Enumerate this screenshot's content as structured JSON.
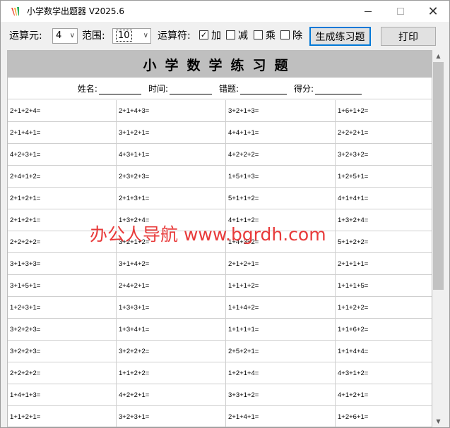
{
  "window": {
    "title": "小学数学出题器 V2025.6",
    "minimize_icon": "minimize-icon",
    "maximize_icon": "maximize-icon",
    "close_glyph": "✕"
  },
  "toolbar": {
    "operands_label": "运算元:",
    "operands_value": "4",
    "range_label": "范围:",
    "range_value": "10",
    "operators_label": "运算符:",
    "add_label": "加",
    "sub_label": "减",
    "mul_label": "乘",
    "div_label": "除",
    "add_checked": true,
    "sub_checked": false,
    "mul_checked": false,
    "div_checked": false,
    "generate_label": "生成练习题",
    "print_label": "打印",
    "check_glyph": "✓",
    "arrow_glyph": "∨"
  },
  "sheet": {
    "title": "小学数学练习题",
    "name_label": "姓名:",
    "time_label": "时间:",
    "errors_label": "错题:",
    "score_label": "得分:"
  },
  "problems": [
    [
      "2+1+2+4=",
      "2+1+4+3=",
      "3+2+1+3=",
      "1+6+1+2="
    ],
    [
      "2+1+4+1=",
      "3+1+2+1=",
      "4+4+1+1=",
      "2+2+2+1="
    ],
    [
      "4+2+3+1=",
      "4+3+1+1=",
      "4+2+2+2=",
      "3+2+3+2="
    ],
    [
      "2+4+1+2=",
      "2+3+2+3=",
      "1+5+1+3=",
      "1+2+5+1="
    ],
    [
      "2+1+2+1=",
      "2+1+3+1=",
      "5+1+1+2=",
      "4+1+4+1="
    ],
    [
      "2+1+2+1=",
      "1+3+2+4=",
      "4+1+1+2=",
      "1+3+2+4="
    ],
    [
      "2+2+2+2=",
      "3+2+1+2=",
      "1+4+3+2=",
      "5+1+2+2="
    ],
    [
      "3+1+3+3=",
      "3+1+4+2=",
      "2+1+2+1=",
      "2+1+1+1="
    ],
    [
      "3+1+5+1=",
      "2+4+2+1=",
      "1+1+1+2=",
      "1+1+1+5="
    ],
    [
      "1+2+3+1=",
      "1+3+3+1=",
      "1+1+4+2=",
      "1+1+2+2="
    ],
    [
      "3+2+2+3=",
      "1+3+4+1=",
      "1+1+1+1=",
      "1+1+6+2="
    ],
    [
      "3+2+2+3=",
      "3+2+2+2=",
      "2+5+2+1=",
      "1+1+4+4="
    ],
    [
      "2+2+2+2=",
      "1+1+2+2=",
      "1+2+1+4=",
      "4+3+1+2="
    ],
    [
      "1+4+1+3=",
      "4+2+2+1=",
      "3+3+1+2=",
      "4+1+2+1="
    ],
    [
      "1+1+2+1=",
      "3+2+3+1=",
      "2+1+4+1=",
      "1+2+6+1="
    ]
  ],
  "watermark": "办公人导航 www.bgrdh.com",
  "colors": {
    "sheet_header_bg": "#bfbfbf",
    "watermark": "#e83a3a",
    "focus_border": "#0078d7"
  }
}
